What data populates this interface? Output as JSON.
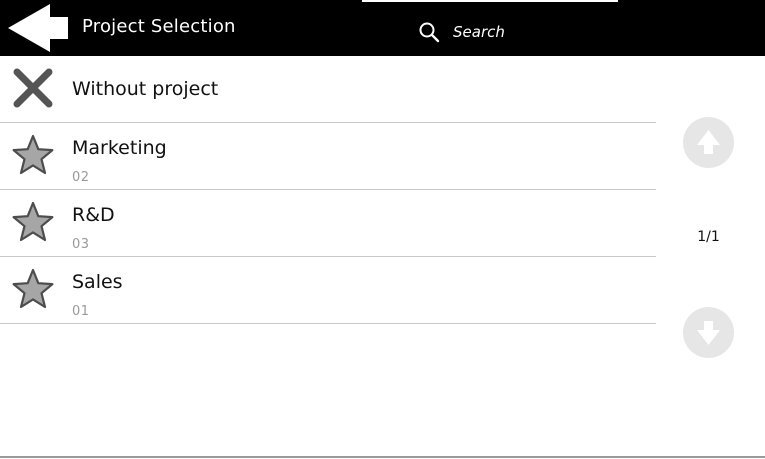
{
  "header": {
    "title": "Project Selection",
    "search_placeholder": "Search",
    "back_icon": "back-arrow-icon",
    "search_icon": "search-icon"
  },
  "projects": [
    {
      "name": "Without project",
      "code": "",
      "icon": "close-icon"
    },
    {
      "name": "Marketing",
      "code": "02",
      "icon": "star-icon"
    },
    {
      "name": "R&D",
      "code": "03",
      "icon": "star-icon"
    },
    {
      "name": "Sales",
      "code": "01",
      "icon": "star-icon"
    }
  ],
  "pager": {
    "indicator": "1/1",
    "up_icon": "arrow-up-icon",
    "down_icon": "arrow-down-icon"
  },
  "colors": {
    "header_bg": "#000000",
    "divider": "#c8c8c8",
    "star_fill": "#a6a6a6",
    "pager_bg": "#e6e6e6",
    "code_text": "#9a9a9a"
  }
}
